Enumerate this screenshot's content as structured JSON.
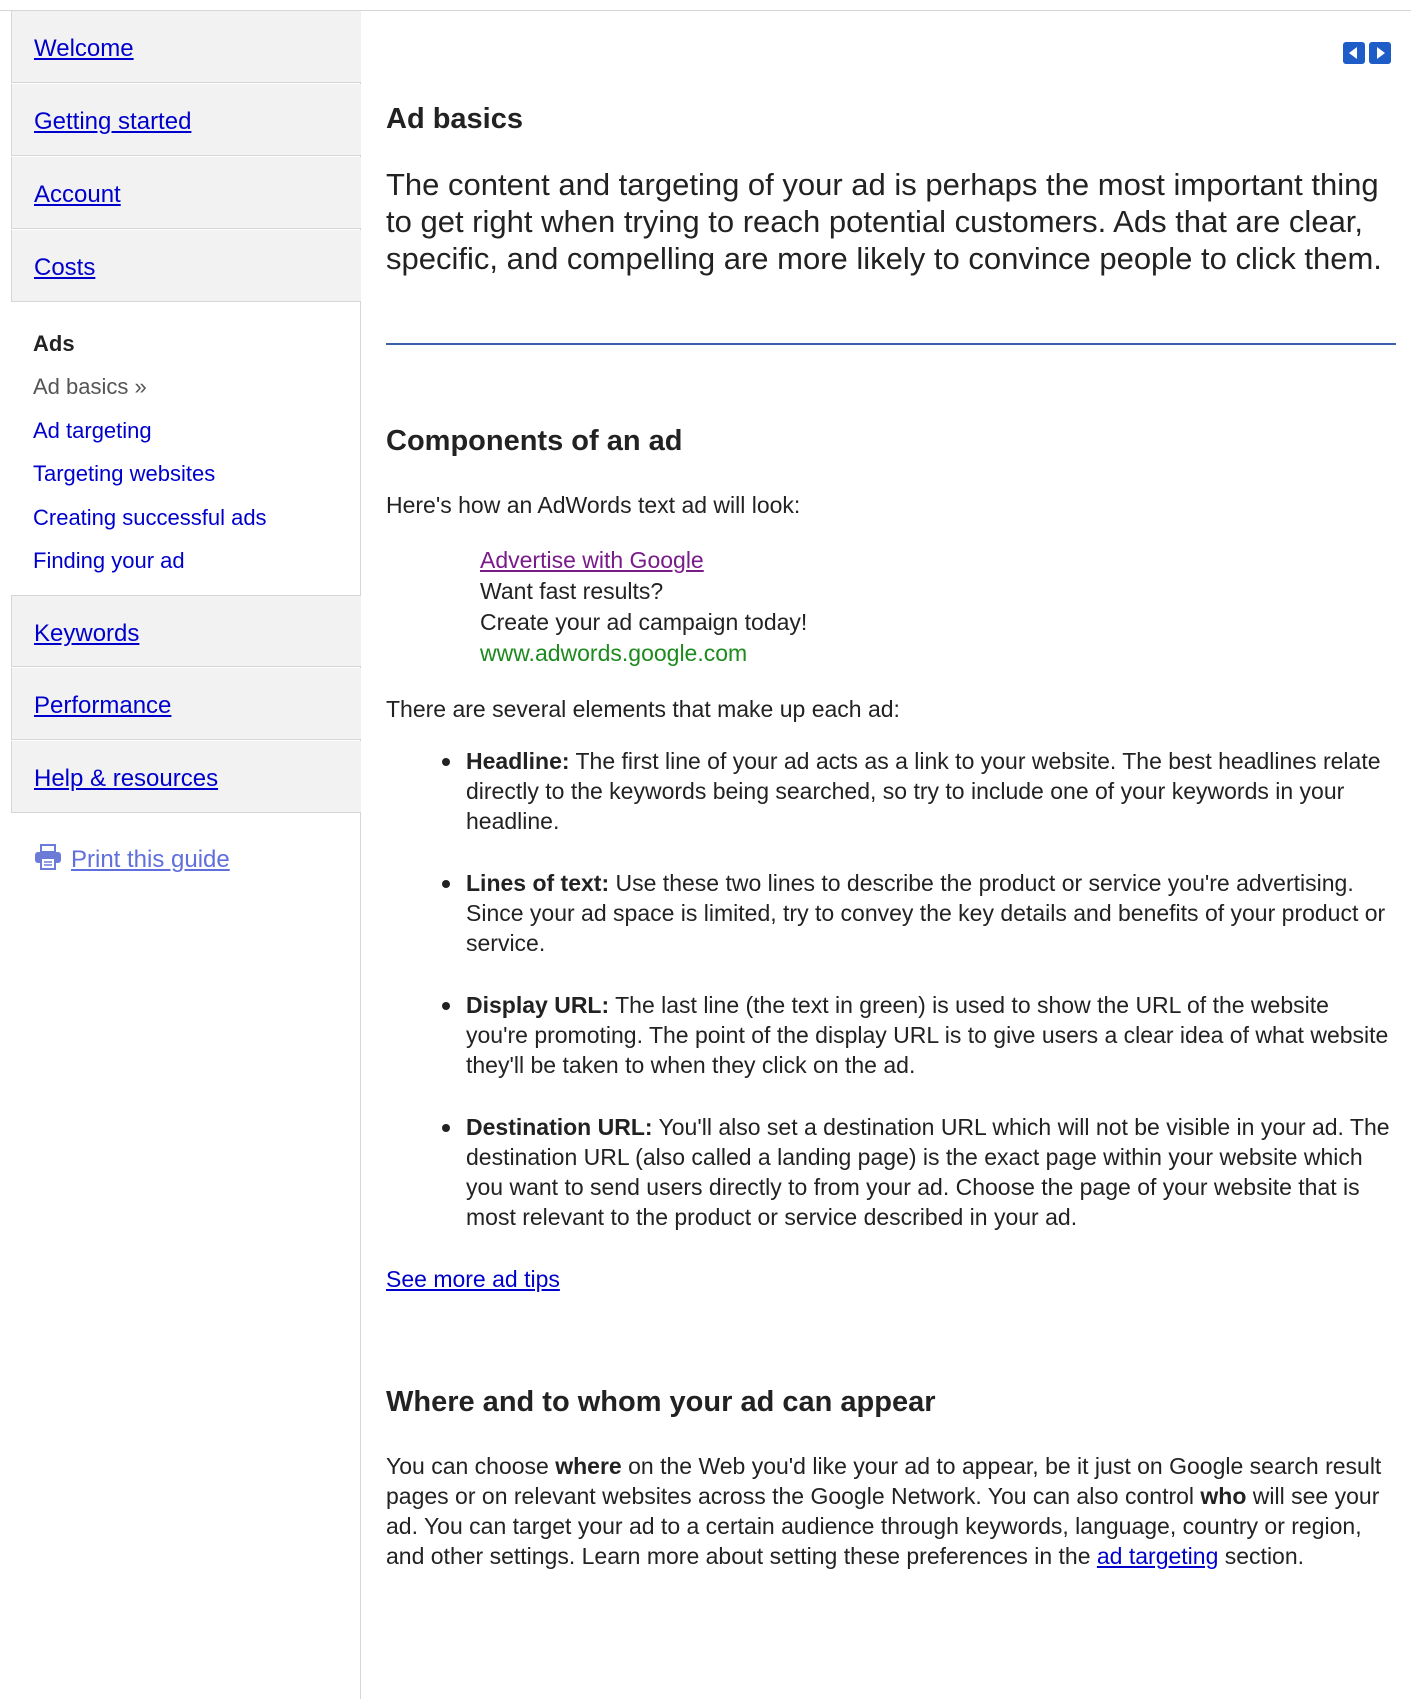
{
  "sidebar": {
    "nav_top": [
      {
        "label": "Welcome"
      },
      {
        "label": "Getting started"
      },
      {
        "label": "Account"
      },
      {
        "label": "Costs"
      }
    ],
    "section": {
      "heading": "Ads",
      "items": [
        {
          "label": "Ad basics »",
          "current": true
        },
        {
          "label": "Ad targeting"
        },
        {
          "label": "Targeting websites"
        },
        {
          "label": "Creating successful ads"
        },
        {
          "label": "Finding your ad"
        }
      ]
    },
    "nav_bottom": [
      {
        "label": "Keywords"
      },
      {
        "label": "Performance"
      },
      {
        "label": "Help & resources"
      }
    ],
    "print_label": "Print this guide",
    "print_icon": "printer-icon"
  },
  "nav_arrows": {
    "prev_icon": "arrow-left-icon",
    "next_icon": "arrow-right-icon"
  },
  "main": {
    "title": "Ad basics",
    "intro": "The content and targeting of your ad is perhaps the most important thing to get right when trying to reach potential customers. Ads that are clear, specific, and compelling are more likely to convince people to click them.",
    "components": {
      "heading": "Components of an ad",
      "lead": "Here's how an AdWords text ad will look:",
      "sample_ad": {
        "headline": "Advertise with Google",
        "line1": "Want fast results?",
        "line2": "Create your ad campaign today!",
        "display_url": "www.adwords.google.com"
      },
      "elements_lead": "There are several elements that make up each ad:",
      "elements": [
        {
          "term": "Headline:",
          "text": " The first line of your ad acts as a link to your website. The best headlines relate directly to the keywords being searched, so try to include one of your keywords in your headline."
        },
        {
          "term": "Lines of text:",
          "text": " Use these two lines to describe the product or service you're advertising. Since your ad space is limited, try to convey the key details and benefits of your product or service."
        },
        {
          "term": "Display URL:",
          "text": " The last line (the text in green) is used to show the URL of the website you're promoting. The point of the display URL is to give users a clear idea of what website they'll be taken to when they click on the ad."
        },
        {
          "term": "Destination URL:",
          "text": " You'll also set a destination URL which will not be visible in your ad. The destination URL (also called a landing page) is the exact page within your website which you want to send users directly to from your ad. Choose the page of your website that is most relevant to the product or service described in your ad."
        }
      ],
      "more_link": "See more ad tips"
    },
    "where": {
      "heading": "Where and to whom your ad can appear",
      "p_part1": "You can choose ",
      "p_bold1": "where",
      "p_part2": " on the Web you'd like your ad to appear, be it just on Google search result pages or on relevant websites across the Google Network. You can also control ",
      "p_bold2": "who",
      "p_part3": " will see your ad. You can target your ad to a certain audience through keywords, language, country or region, and other settings. Learn more about setting these preferences in the ",
      "p_link": "ad targeting",
      "p_part4": " section."
    }
  }
}
